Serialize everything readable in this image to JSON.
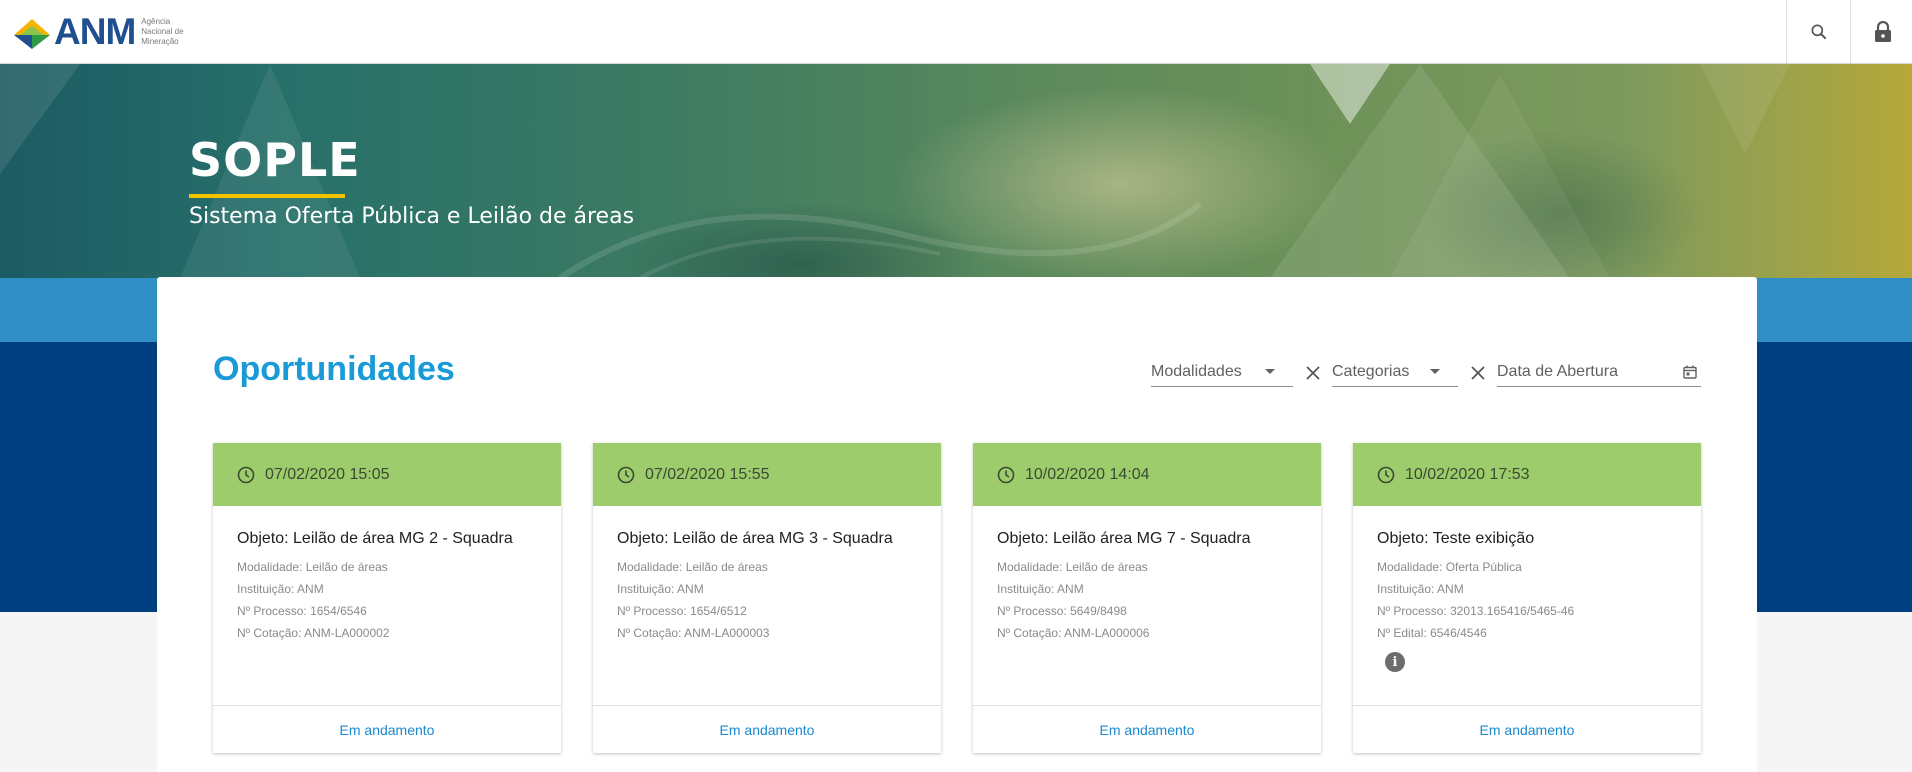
{
  "header": {
    "logo_text": "ANM",
    "logo_sub": "Agência Nacional de Mineração",
    "search_icon": "search-icon",
    "lock_icon": "lock-icon"
  },
  "hero": {
    "title": "SOPLE",
    "subtitle": "Sistema Oferta Pública e Leilão de áreas"
  },
  "main": {
    "title": "Oportunidades",
    "filters": {
      "modalidades": "Modalidades",
      "categorias": "Categorias",
      "data_abertura": "Data de Abertura"
    }
  },
  "cards": [
    {
      "datetime": "07/02/2020 15:05",
      "objeto": "Objeto: Leilão de área MG 2 - Squadra",
      "modalidade": "Modalidade: Leilão de áreas",
      "instituicao": "Instituição: ANM",
      "processo": "Nº Processo: 1654/6546",
      "extra": "Nº Cotação: ANM-LA000002",
      "status": "Em andamento"
    },
    {
      "datetime": "07/02/2020 15:55",
      "objeto": "Objeto: Leilão de área MG 3 - Squadra",
      "modalidade": "Modalidade: Leilão de áreas",
      "instituicao": "Instituição: ANM",
      "processo": "Nº Processo: 1654/6512",
      "extra": "Nº Cotação: ANM-LA000003",
      "status": "Em andamento"
    },
    {
      "datetime": "10/02/2020 14:04",
      "objeto": "Objeto: Leilão área MG 7 - Squadra",
      "modalidade": "Modalidade: Leilão de áreas",
      "instituicao": "Instituição: ANM",
      "processo": "Nº Processo: 5649/8498",
      "extra": "Nº Cotação: ANM-LA000006",
      "status": "Em andamento"
    },
    {
      "datetime": "10/02/2020 17:53",
      "objeto": "Objeto: Teste exibição",
      "modalidade": "Modalidade: Oferta Pública",
      "instituicao": "Instituição: ANM",
      "processo": "Nº Processo: 32013.165416/5465-46",
      "extra": "Nº Edital: 6546/4546",
      "status": "Em andamento"
    }
  ],
  "colors": {
    "card_header": "#9ccc6b",
    "title_blue": "#1a9ad6",
    "band_blue": "#003f7f",
    "accent_yellow": "#f4c300"
  }
}
